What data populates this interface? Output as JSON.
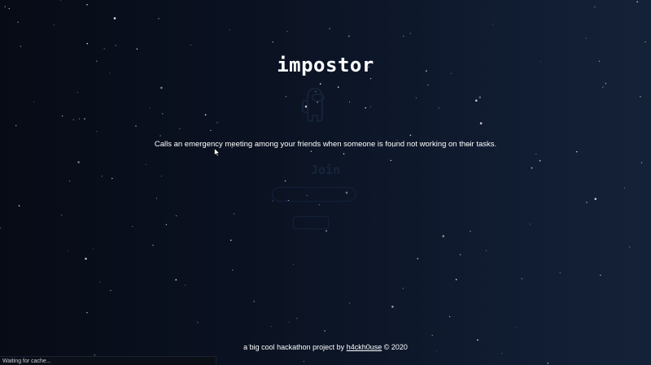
{
  "app": {
    "title": "impostor",
    "subtitle": "Calls an emergency meeting among your friends when someone is found not working on their tasks."
  },
  "background_form": {
    "heading": "Join",
    "input_placeholder": "",
    "button_label": ""
  },
  "footer": {
    "prefix": "a big cool hackathon project by ",
    "link_text": "h4ckh0use",
    "suffix": " © 2020"
  },
  "status_bar": {
    "text": "Waiting for cache..."
  },
  "colors": {
    "background_left": "#070b16",
    "background_right": "#142238",
    "text": "#ffffff",
    "ghost": "#15253b"
  },
  "icons": {
    "figure": "crewmate-icon",
    "cursor": "mouse-pointer-icon"
  }
}
